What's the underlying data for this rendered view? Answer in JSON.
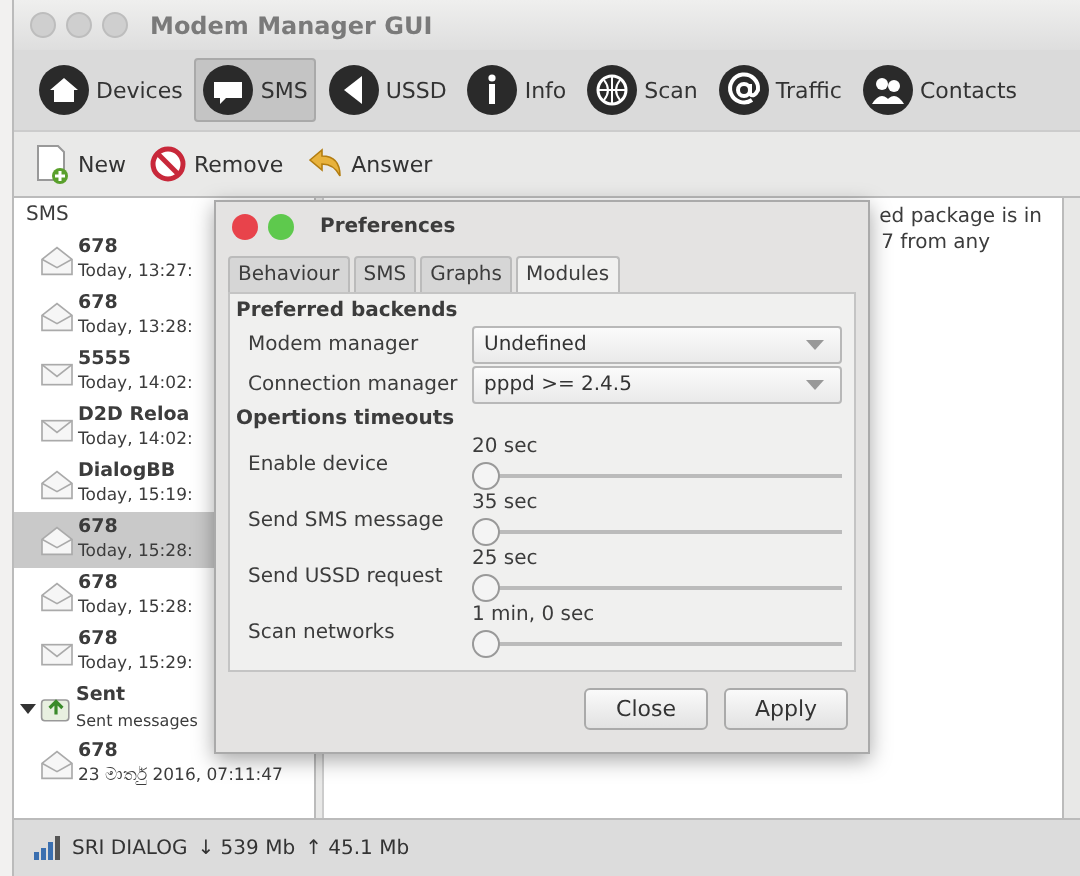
{
  "window": {
    "title": "Modem Manager GUI"
  },
  "tabs": [
    {
      "label": "Devices",
      "selected": false
    },
    {
      "label": "SMS",
      "selected": true
    },
    {
      "label": "USSD",
      "selected": false
    },
    {
      "label": "Info",
      "selected": false
    },
    {
      "label": "Scan",
      "selected": false
    },
    {
      "label": "Traffic",
      "selected": false
    },
    {
      "label": "Contacts",
      "selected": false
    }
  ],
  "actions": [
    "New",
    "Remove",
    "Answer"
  ],
  "sms_list": {
    "header": "SMS",
    "messages": [
      {
        "sender": "678",
        "time": "Today, 13:27:",
        "read": true,
        "selected": false
      },
      {
        "sender": "678",
        "time": "Today, 13:28:",
        "read": true,
        "selected": false
      },
      {
        "sender": "5555",
        "time": "Today, 14:02:",
        "read": false,
        "selected": false
      },
      {
        "sender": "D2D Reloa",
        "time": "Today, 14:02:",
        "read": false,
        "selected": false
      },
      {
        "sender": "DialogBB",
        "time": "Today, 15:19:",
        "read": true,
        "selected": false
      },
      {
        "sender": "678",
        "time": "Today, 15:28:",
        "read": true,
        "selected": true
      },
      {
        "sender": "678",
        "time": "Today, 15:28:",
        "read": true,
        "selected": false
      },
      {
        "sender": "678",
        "time": "Today, 15:29:",
        "read": false,
        "selected": false
      }
    ],
    "folder": {
      "name": "Sent",
      "description": "Sent messages",
      "expanded": true
    },
    "sent": [
      {
        "sender": "678",
        "time": "23 මාර්තු 2016, 07:11:47",
        "read": true,
        "selected": false
      }
    ]
  },
  "message_text": [
    "ed package is in",
    "7 from any"
  ],
  "status_bar": {
    "operator": "SRI DIALOG",
    "download": "↓ 539 Mb",
    "upload": "↑ 45.1 Mb"
  },
  "dialog": {
    "title": "Preferences",
    "tabs": [
      {
        "label": "Behaviour",
        "selected": false
      },
      {
        "label": "SMS",
        "selected": false
      },
      {
        "label": "Graphs",
        "selected": false
      },
      {
        "label": "Modules",
        "selected": true
      }
    ],
    "backends_heading": "Preferred backends",
    "backends": [
      {
        "label": "Modem manager",
        "value": "Undefined"
      },
      {
        "label": "Connection manager",
        "value": "pppd >= 2.4.5"
      }
    ],
    "timeouts_heading": "Opertions timeouts",
    "timeouts": [
      {
        "label": "Enable device",
        "reading": "20 sec",
        "level": 0
      },
      {
        "label": "Send SMS message",
        "reading": "35 sec",
        "level": 0
      },
      {
        "label": "Send USSD request",
        "reading": "25 sec",
        "level": 0
      },
      {
        "label": "Scan networks",
        "reading": "1 min, 0 sec",
        "level": 0
      }
    ],
    "buttons": [
      "Close",
      "Apply"
    ]
  }
}
